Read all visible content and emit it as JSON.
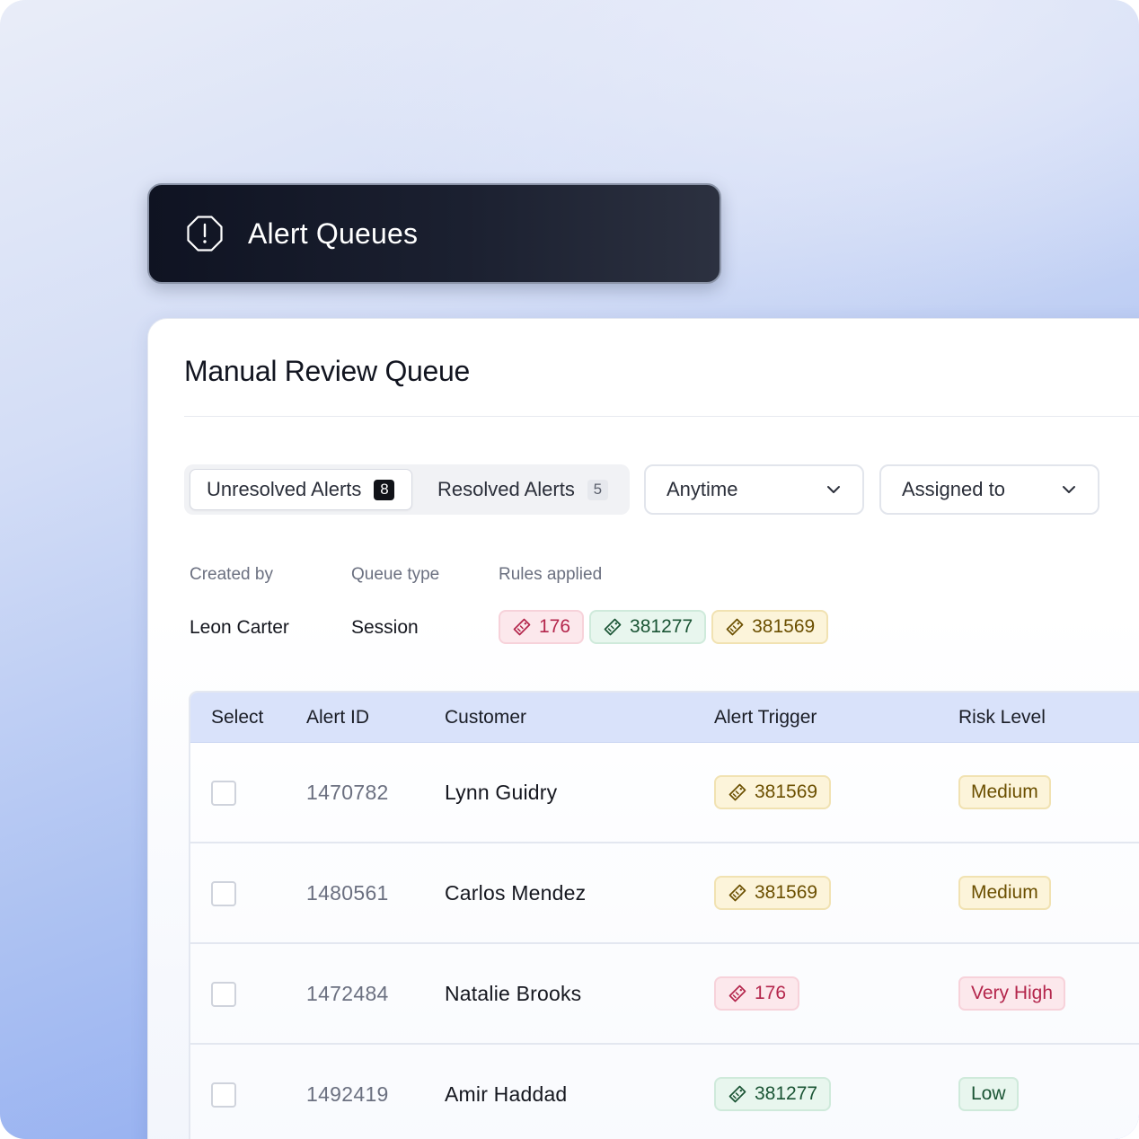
{
  "header": {
    "title": "Alert Queues",
    "icon": "alert-octagon-icon"
  },
  "queue": {
    "title": "Manual Review Queue"
  },
  "tabs": [
    {
      "label": "Unresolved Alerts",
      "count": "8",
      "active": true
    },
    {
      "label": "Resolved Alerts",
      "count": "5",
      "active": false
    }
  ],
  "filters": {
    "time": {
      "value": "Anytime"
    },
    "assigned": {
      "value": "Assigned to"
    }
  },
  "meta": {
    "created_by": {
      "label": "Created by",
      "value": "Leon Carter"
    },
    "queue_type": {
      "label": "Queue type",
      "value": "Session"
    },
    "rules_applied": {
      "label": "Rules applied",
      "rules": [
        {
          "id": "176",
          "color": "red"
        },
        {
          "id": "381277",
          "color": "green"
        },
        {
          "id": "381569",
          "color": "yellow"
        }
      ]
    }
  },
  "table": {
    "columns": [
      "Select",
      "Alert ID",
      "Customer",
      "Alert Trigger",
      "Risk Level"
    ],
    "rows": [
      {
        "alert_id": "1470782",
        "customer": "Lynn Guidry",
        "trigger": "381569",
        "trigger_color": "yellow",
        "risk": "Medium",
        "risk_class": "medium"
      },
      {
        "alert_id": "1480561",
        "customer": "Carlos Mendez",
        "trigger": "381569",
        "trigger_color": "yellow",
        "risk": "Medium",
        "risk_class": "medium"
      },
      {
        "alert_id": "1472484",
        "customer": "Natalie Brooks",
        "trigger": "176",
        "trigger_color": "red",
        "risk": "Very High",
        "risk_class": "veryhigh"
      },
      {
        "alert_id": "1492419",
        "customer": "Amir Haddad",
        "trigger": "381277",
        "trigger_color": "green",
        "risk": "Low",
        "risk_class": "low"
      }
    ]
  },
  "colors": {
    "header_bg": "#141826",
    "table_header_bg": "#d9e2fa",
    "tag_red": "#b4264c",
    "tag_green": "#1a5434",
    "tag_yellow": "#6b4f00"
  }
}
